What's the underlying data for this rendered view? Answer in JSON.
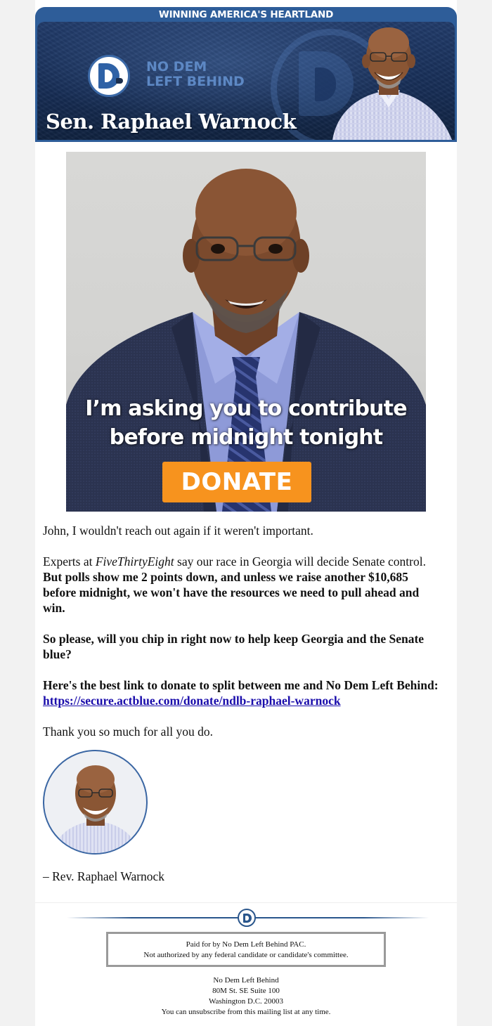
{
  "header": {
    "tagline": "WINNING AMERICA'S HEARTLAND",
    "logo_line1": "NO DEM",
    "logo_line2": "LEFT BEHIND",
    "name": "Sen. Raphael Warnock"
  },
  "hero": {
    "caption_line1": "I’m asking you to contribute",
    "caption_line2": "before midnight tonight",
    "donate_label": "DONATE"
  },
  "body": {
    "greeting": "John, I wouldn't reach out again if it weren't important.",
    "p2_a": "Experts at ",
    "p2_source": "FiveThirtyEight",
    "p2_b": " say our race in Georgia will decide Senate control. ",
    "p2_bold": "But polls show me 2 points down, and unless we raise another $10,685 before midnight, we won't have the resources we need to pull ahead and win.",
    "p3": "So please, will you chip in right now to help keep Georgia and the Senate blue?",
    "p4_bold": "Here's the best link to donate to split between me and No Dem Left Behind: ",
    "p4_link": "https://secure.actblue.com/donate/ndlb-raphael-warnock",
    "p5": "Thank you so much for all you do.",
    "signature": "– Rev. Raphael Warnock"
  },
  "footer": {
    "disclaimer_line1": "Paid for by No Dem Left Behind PAC.",
    "disclaimer_line2": "Not authorized by any federal candidate or candidate's committee.",
    "org": "No Dem Left Behind",
    "street": "80M St. SE Suite 100",
    "city": "Washington D.C. 20003",
    "unsubscribe": "You can unsubscribe from this mailing list at any time."
  },
  "colors": {
    "banner_blue": "#2e5d99",
    "donate_orange": "#f7931e",
    "link_blue": "#1a0dab"
  }
}
